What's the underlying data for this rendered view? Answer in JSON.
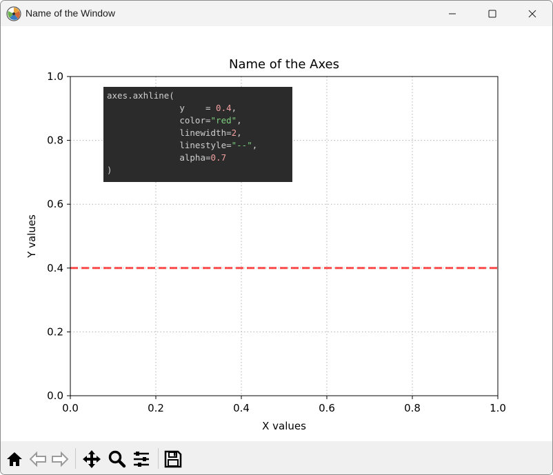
{
  "window": {
    "title": "Name of the Window",
    "minimize_icon": "minimize-icon",
    "maximize_icon": "maximize-icon",
    "close_icon": "close-icon"
  },
  "chart_data": {
    "type": "line",
    "title": "Name of the Axes",
    "xlabel": "X values",
    "ylabel": "Y values",
    "xlim": [
      0.0,
      1.0
    ],
    "ylim": [
      0.0,
      1.0
    ],
    "xticks": [
      "0.0",
      "0.2",
      "0.4",
      "0.6",
      "0.8",
      "1.0"
    ],
    "yticks": [
      "0.0",
      "0.2",
      "0.4",
      "0.6",
      "0.8",
      "1.0"
    ],
    "grid": true,
    "grid_style": "dotted",
    "series": [
      {
        "x": [
          0.0,
          1.0
        ],
        "y": [
          0.4,
          0.4
        ],
        "color": "#ff0000",
        "linestyle": "--",
        "alpha": 0.7
      }
    ]
  },
  "code_box": {
    "background": "#2b2b2b",
    "lines": [
      [
        {
          "t": "axes.axhline(",
          "c": "plain"
        }
      ],
      [
        {
          "t": "              y    = ",
          "c": "plain"
        },
        {
          "t": "0.4",
          "c": "num"
        },
        {
          "t": ",",
          "c": "plain"
        }
      ],
      [
        {
          "t": "              color=",
          "c": "plain"
        },
        {
          "t": "\"red\"",
          "c": "str"
        },
        {
          "t": ",",
          "c": "plain"
        }
      ],
      [
        {
          "t": "              linewidth=",
          "c": "plain"
        },
        {
          "t": "2",
          "c": "num"
        },
        {
          "t": ",",
          "c": "plain"
        }
      ],
      [
        {
          "t": "              linestyle=",
          "c": "plain"
        },
        {
          "t": "\"--\"",
          "c": "str"
        },
        {
          "t": ",",
          "c": "plain"
        }
      ],
      [
        {
          "t": "              alpha=",
          "c": "plain"
        },
        {
          "t": "0.7",
          "c": "num"
        }
      ],
      [
        {
          "t": ")",
          "c": "plain"
        }
      ]
    ]
  },
  "toolbar": {
    "items": [
      {
        "name": "home-button",
        "icon": "home-icon"
      },
      {
        "name": "back-button",
        "icon": "arrow-left-icon"
      },
      {
        "name": "forward-button",
        "icon": "arrow-right-icon"
      },
      {
        "name": "pan-button",
        "icon": "move-icon"
      },
      {
        "name": "zoom-button",
        "icon": "magnifier-icon"
      },
      {
        "name": "configure-subplots-button",
        "icon": "sliders-icon"
      },
      {
        "name": "save-button",
        "icon": "floppy-disk-icon"
      }
    ]
  }
}
